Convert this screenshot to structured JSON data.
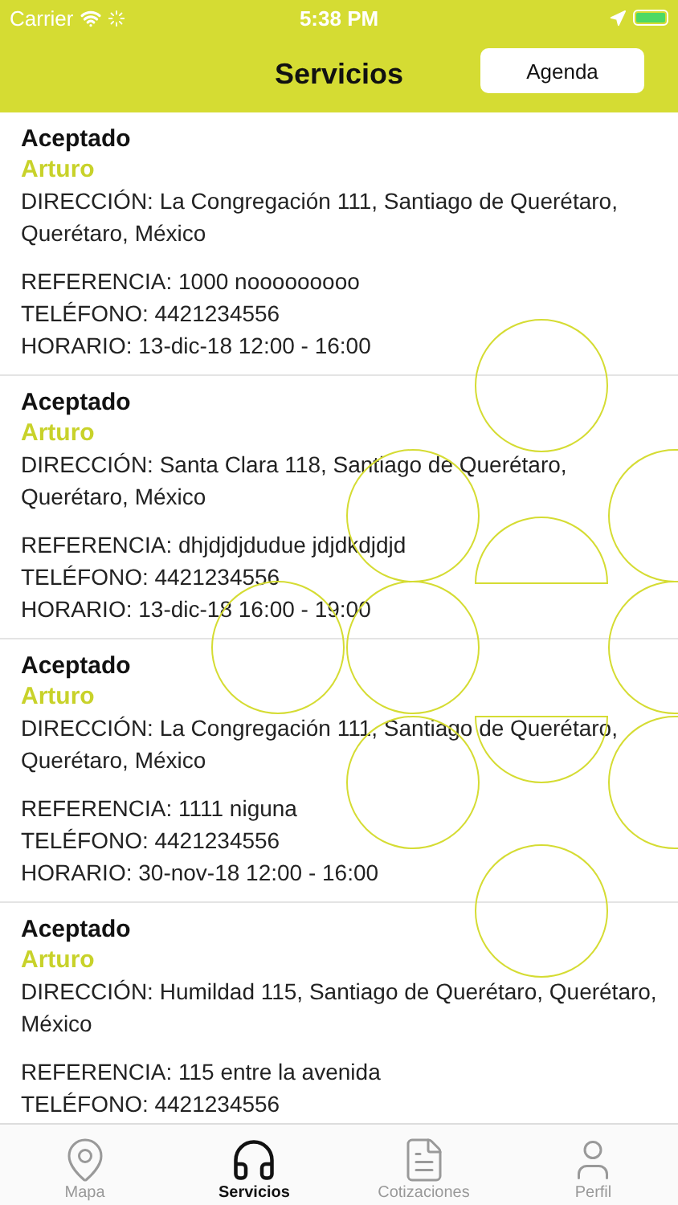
{
  "status_bar": {
    "carrier": "Carrier",
    "time": "5:38 PM"
  },
  "nav": {
    "title": "Servicios",
    "button": "Agenda"
  },
  "services": [
    {
      "status": "Aceptado",
      "name": "Arturo",
      "address": "DIRECCIÓN: La Congregación 111, Santiago de Querétaro, Querétaro, México",
      "details": [
        "REFERENCIA: 1000 nooooooooo",
        "TELÉFONO: 4421234556",
        "HORARIO: 13-dic-18 12:00 - 16:00"
      ]
    },
    {
      "status": "Aceptado",
      "name": "Arturo",
      "address": "DIRECCIÓN: Santa Clara 118, Santiago de Querétaro, Querétaro, México",
      "details": [
        "REFERENCIA: dhjdjdjdudue jdjdkdjdjd",
        "TELÉFONO: 4421234556",
        "HORARIO: 13-dic-18 16:00 - 19:00"
      ]
    },
    {
      "status": "Aceptado",
      "name": "Arturo",
      "address": "DIRECCIÓN: La Congregación 111, Santiago de Querétaro, Querétaro, México",
      "details": [
        "REFERENCIA: 1111 niguna",
        "TELÉFONO: 4421234556",
        "HORARIO: 30-nov-18 12:00 - 16:00"
      ]
    },
    {
      "status": "Aceptado",
      "name": "Arturo",
      "address": "DIRECCIÓN: Humildad 115, Santiago de Querétaro, Querétaro, México",
      "details": [
        "REFERENCIA: 115 entre la avenida",
        "TELÉFONO: 4421234556"
      ]
    }
  ],
  "tabs": [
    {
      "kind": "map",
      "label": "Mapa",
      "selected": false
    },
    {
      "kind": "headset",
      "label": "Servicios",
      "selected": true
    },
    {
      "kind": "invoice",
      "label": "Cotizaciones",
      "selected": false
    },
    {
      "kind": "profile",
      "label": "Perfil",
      "selected": false
    }
  ]
}
